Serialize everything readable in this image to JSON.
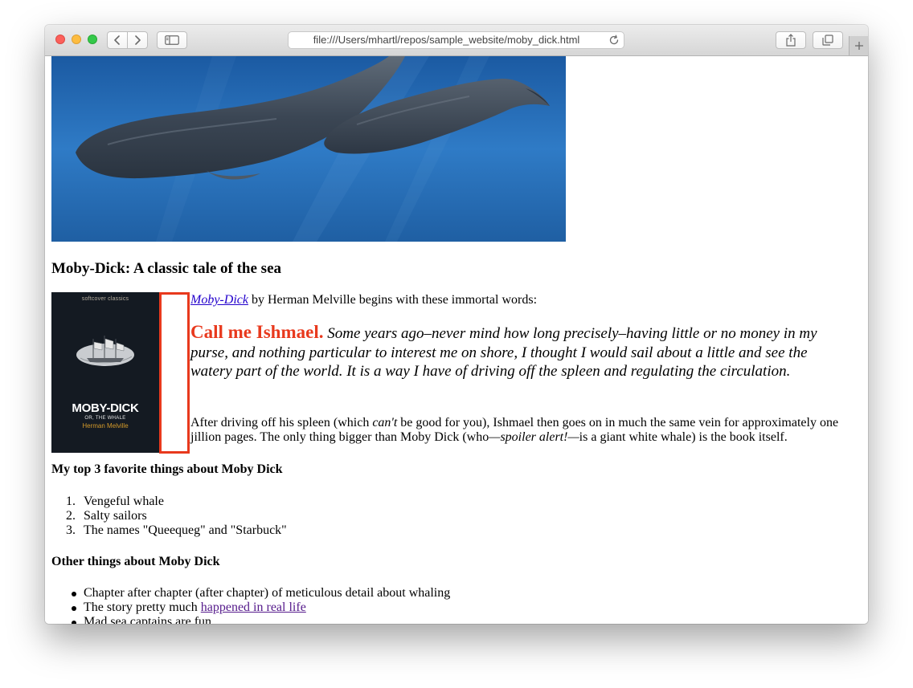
{
  "browser": {
    "url": "file:///Users/mhartl/repos/sample_website/moby_dick.html"
  },
  "page": {
    "heading": "Moby-Dick: A classic tale of the sea",
    "intro": {
      "link_text": "Moby-Dick",
      "rest": " by Herman Melville begins with these immortal words:"
    },
    "quote": {
      "lead": "Call me Ishmael.",
      "body": " Some years ago–never mind how long precisely–having little or no money in my purse, and nothing particular to interest me on shore, I thought I would sail about a little and see the watery part of the world. It is a way I have of driving off the spleen and regulating the circulation."
    },
    "paragraph": {
      "part1": "After driving off his spleen (which ",
      "em1": "can't",
      "part2": " be good for you), Ishmael then goes on in much the same vein for approximately one jillion pages. The only thing bigger than Moby Dick (who",
      "em2": "—spoiler alert!—",
      "part3": "is a giant white whale) is the book itself."
    },
    "cover": {
      "series": "softcover classics",
      "title": "MOBY-DICK",
      "subtitle": "OR, THE WHALE",
      "author": "Herman Melville"
    },
    "favorites": {
      "heading": "My top 3 favorite things about Moby Dick",
      "items": [
        {
          "num": "1.",
          "text": "Vengeful whale"
        },
        {
          "num": "2.",
          "text": "Salty sailors"
        },
        {
          "num": "3.",
          "text": "The names \"Queequeg\" and \"Starbuck\""
        }
      ]
    },
    "other": {
      "heading": "Other things about Moby Dick",
      "items": [
        {
          "text": "Chapter after chapter (after chapter) of meticulous detail about whaling"
        },
        {
          "text": "The story pretty much ",
          "link": "happened in real life"
        },
        {
          "text": "Mad sea captains are fun"
        }
      ]
    }
  },
  "colors": {
    "accent_red": "#e8391d",
    "link_blue": "#2200cc",
    "link_visited": "#551a8b",
    "ocean": "#2a6fb8"
  },
  "icons": {
    "back": "chevron-left-icon",
    "forward": "chevron-right-icon",
    "sidebar": "sidebar-icon",
    "reload": "reload-icon",
    "share": "share-icon",
    "tabs": "tabs-overview-icon",
    "new_tab": "plus-icon"
  }
}
